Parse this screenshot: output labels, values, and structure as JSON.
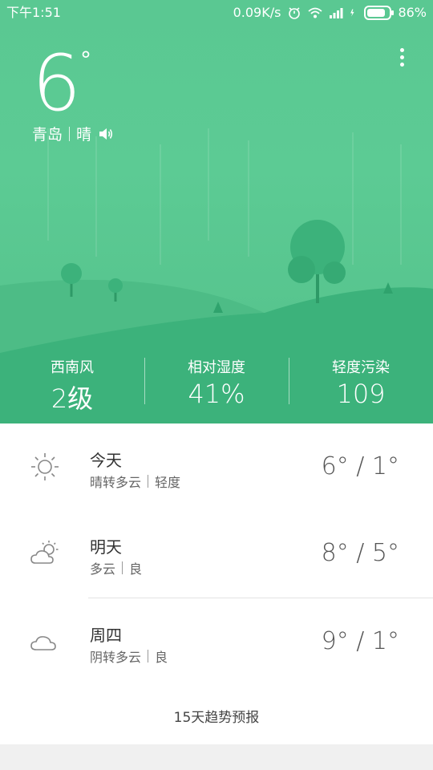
{
  "status_bar": {
    "time": "下午1:51",
    "speed": "0.09K/s",
    "battery": "86%",
    "battery_level": 0.86
  },
  "current": {
    "temperature": "6",
    "degree_symbol": "°",
    "city": "青岛",
    "condition": "晴"
  },
  "stats": [
    {
      "label": "西南风",
      "value": "2级"
    },
    {
      "label": "相对湿度",
      "value": "41%"
    },
    {
      "label": "轻度污染",
      "value": "109"
    }
  ],
  "forecast": [
    {
      "day": "今天",
      "weather": "晴转多云",
      "air": "轻度",
      "temp": "6° / 1°",
      "icon": "sun-icon"
    },
    {
      "day": "明天",
      "weather": "多云",
      "air": "良",
      "temp": "8° / 5°",
      "icon": "partly-cloudy-icon"
    },
    {
      "day": "周四",
      "weather": "阴转多云",
      "air": "良",
      "temp": "9° / 1°",
      "icon": "cloud-icon"
    }
  ],
  "forecast_link": "15天趋势预报",
  "colors": {
    "hero_green": "#5ac892",
    "hill_dark": "#3fb07a",
    "text_dark": "#333333"
  }
}
